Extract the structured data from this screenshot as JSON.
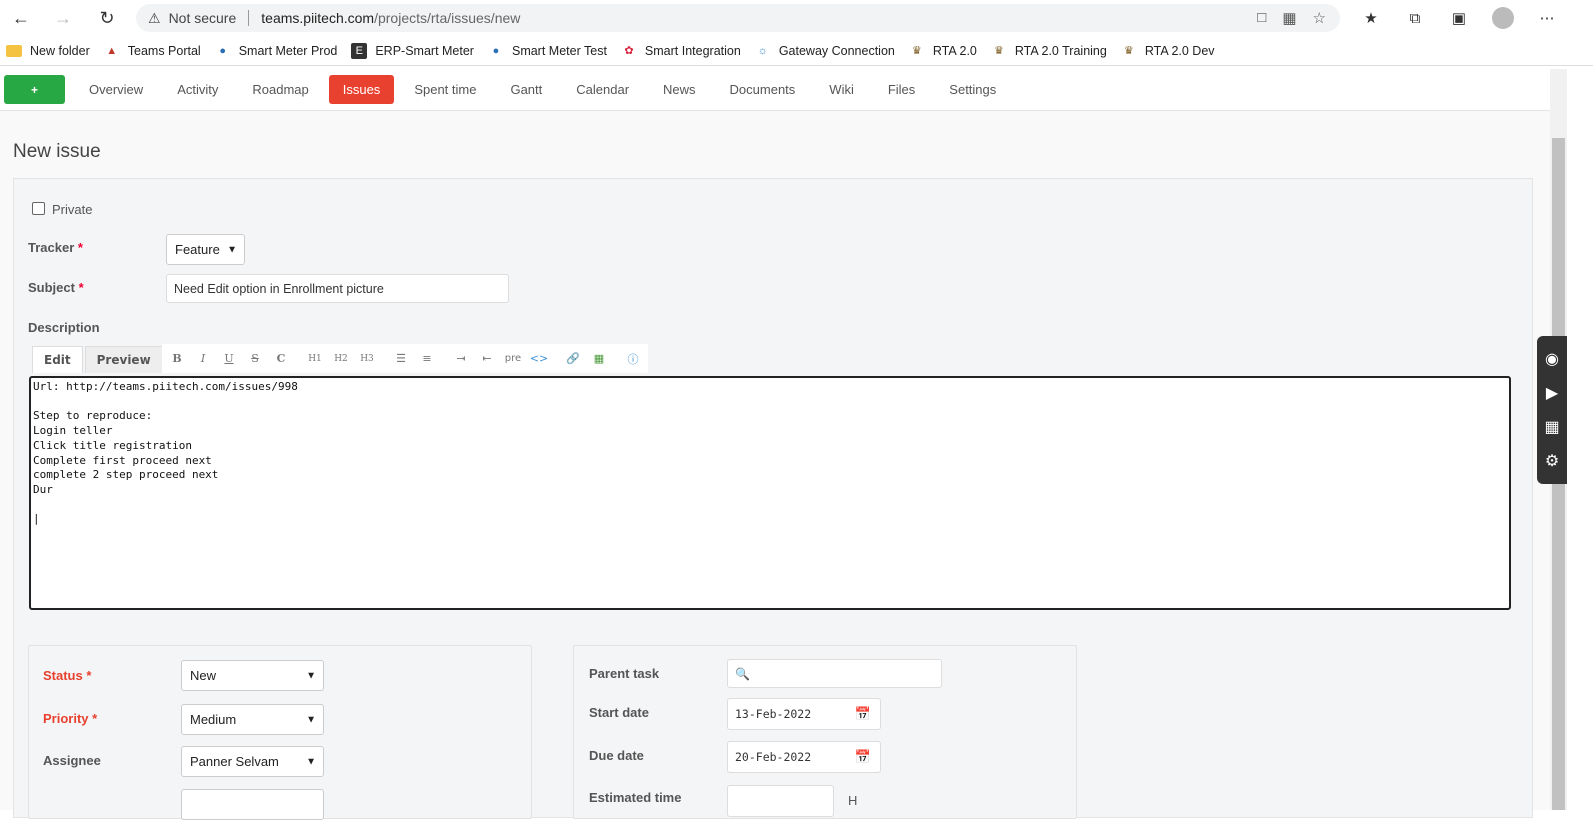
{
  "browser": {
    "security_label": "Not secure",
    "url_host": "teams.piitech.com",
    "url_path": "/projects/rta/issues/new"
  },
  "bookmarks": [
    {
      "label": "New folder",
      "icon": "folder-icon"
    },
    {
      "label": "Teams Portal",
      "icon": "teams-icon"
    },
    {
      "label": "Smart Meter Prod",
      "icon": "drop-icon"
    },
    {
      "label": "ERP-Smart Meter",
      "icon": "erp-icon"
    },
    {
      "label": "Smart Meter Test",
      "icon": "drop-icon"
    },
    {
      "label": "Smart Integration",
      "icon": "huawei-icon"
    },
    {
      "label": "Gateway Connection",
      "icon": "globe-icon"
    },
    {
      "label": "RTA 2.0",
      "icon": "emblem-icon"
    },
    {
      "label": "RTA 2.0 Training",
      "icon": "emblem-icon"
    },
    {
      "label": "RTA 2.0 Dev",
      "icon": "emblem-icon"
    }
  ],
  "menu": {
    "plus": "+",
    "tabs": [
      "Overview",
      "Activity",
      "Roadmap",
      "Issues",
      "Spent time",
      "Gantt",
      "Calendar",
      "News",
      "Documents",
      "Wiki",
      "Files",
      "Settings"
    ],
    "active": "Issues"
  },
  "page": {
    "title": "New issue"
  },
  "form": {
    "private_label": "Private",
    "tracker_label": "Tracker",
    "tracker_value": "Feature",
    "subject_label": "Subject",
    "subject_value": "Need Edit option in Enrollment picture",
    "description_label": "Description",
    "edit_tab": "Edit",
    "preview_tab": "Preview",
    "toolbar": [
      "B",
      "I",
      "U",
      "S",
      "C",
      "H1",
      "H2",
      "H3",
      "ul",
      "ol",
      "indent",
      "outdent",
      "pre",
      "code",
      "link",
      "image",
      "help"
    ],
    "description_text": "Url: http://teams.piitech.com/issues/998\n\nStep to reproduce:\nLogin teller\nClick title registration\nComplete first proceed next\ncomplete 2 step proceed next\nDur\n\n|",
    "status_label": "Status",
    "status_value": "New",
    "priority_label": "Priority",
    "priority_value": "Medium",
    "assignee_label": "Assignee",
    "assignee_value": "Panner Selvam",
    "parent_label": "Parent task",
    "start_label": "Start date",
    "start_value": "13-Feb-2022",
    "due_label": "Due date",
    "due_value": "20-Feb-2022",
    "estimated_label": "Estimated time",
    "hours_label": "H"
  }
}
